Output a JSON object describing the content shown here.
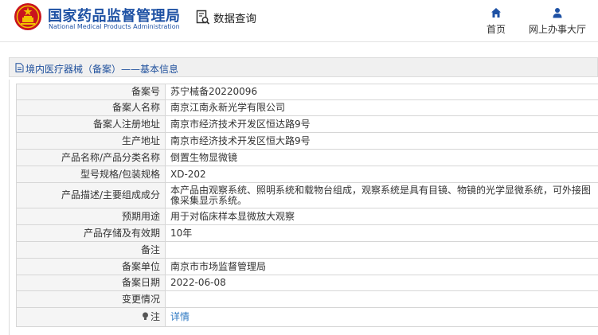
{
  "header": {
    "org_name_cn": "国家药品监督管理局",
    "org_name_en": "National Medical Products Administration",
    "data_query": "数据查询",
    "nav": [
      {
        "label": "首页",
        "icon": "home-icon"
      },
      {
        "label": "网上办事大厅",
        "icon": "user-icon"
      }
    ]
  },
  "section": {
    "title": "境内医疗器械（备案）——基本信息"
  },
  "records": {
    "filing_no": {
      "label": "备案号",
      "value": "苏宁械备20220096"
    },
    "filer_name": {
      "label": "备案人名称",
      "value": "南京江南永新光学有限公司"
    },
    "filer_address": {
      "label": "备案人注册地址",
      "value": "南京市经济技术开发区恒达路9号"
    },
    "production_address": {
      "label": "生产地址",
      "value": "南京市经济技术开发区恒大路9号"
    },
    "product_name": {
      "label": "产品名称/产品分类名称",
      "value": "倒置生物显微镜"
    },
    "model_spec": {
      "label": "型号规格/包装规格",
      "value": "XD-202"
    },
    "description": {
      "label": "产品描述/主要组成成分",
      "value": "本产品由观察系统、照明系统和载物台组成，观察系统是具有目镜、物镜的光学显微系统，可外接图像采集显示系统。"
    },
    "intended_use": {
      "label": "预期用途",
      "value": "用于对临床样本显微放大观察"
    },
    "storage": {
      "label": "产品存储及有效期",
      "value": "10年"
    },
    "remark": {
      "label": "备注",
      "value": ""
    },
    "filing_unit": {
      "label": "备案单位",
      "value": "南京市市场监督管理局"
    },
    "filing_date": {
      "label": "备案日期",
      "value": "2022-06-08"
    },
    "change_info": {
      "label": "变更情况",
      "value": ""
    },
    "note": {
      "label": "注",
      "value": "详情"
    }
  },
  "colors": {
    "brand": "#1e51a4",
    "link": "#2b77c2",
    "label_bg": "#f5f5f5",
    "border": "#d6d6d6"
  }
}
